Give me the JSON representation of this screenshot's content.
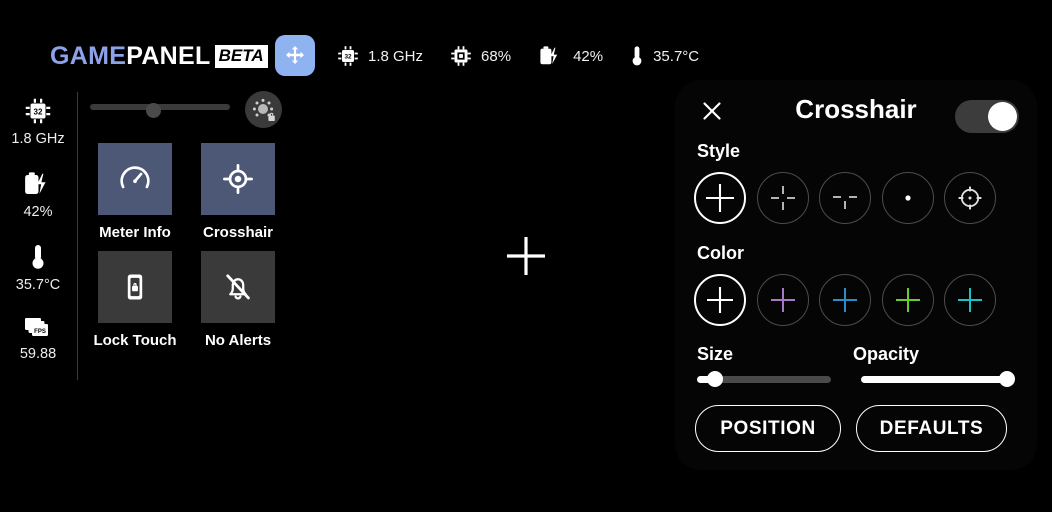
{
  "app": {
    "brand_first": "GAME",
    "brand_second": "PANEL",
    "brand_badge": "BETA",
    "move_icon": "move-arrows-icon",
    "brand_accent": "#8da2e8",
    "move_button_color": "#8fb2f0"
  },
  "statusbar": {
    "items": [
      {
        "icon": "cpu-chip-icon",
        "value": "1.8 GHz"
      },
      {
        "icon": "gpu-chip-icon",
        "value": "68%"
      },
      {
        "icon": "battery-charging-icon",
        "value": "42%"
      },
      {
        "icon": "thermometer-icon",
        "value": "35.7°C"
      }
    ]
  },
  "rail": {
    "items": [
      {
        "icon": "cpu-chip-icon",
        "value": "1.8 GHz"
      },
      {
        "icon": "battery-charging-icon",
        "value": "42%"
      },
      {
        "icon": "thermometer-icon",
        "value": "35.7°C"
      },
      {
        "icon": "fps-frames-icon",
        "value": "59.88"
      }
    ]
  },
  "brightness": {
    "slider_percent": 40,
    "lock_button_icon": "brightness-lock-icon"
  },
  "tiles": [
    {
      "label": "Meter Info",
      "icon": "speedometer-icon",
      "active": true
    },
    {
      "label": "Crosshair",
      "icon": "crosshair-target-icon",
      "active": true
    },
    {
      "label": "Lock Touch",
      "icon": "phone-lock-icon",
      "active": false
    },
    {
      "label": "No Alerts",
      "icon": "bell-off-icon",
      "active": false
    }
  ],
  "overlay_preview": {
    "icon": "crosshair-plus-icon",
    "color": "#ffffff"
  },
  "panel": {
    "title": "Crosshair",
    "close_icon": "close-x-icon",
    "enabled": true,
    "style": {
      "label": "Style",
      "selected_index": 0,
      "options": [
        {
          "name": "plain-cross",
          "selected": true
        },
        {
          "name": "gapped-cross",
          "selected": false
        },
        {
          "name": "t-cross",
          "selected": false
        },
        {
          "name": "dot",
          "selected": false
        },
        {
          "name": "scope-reticle",
          "selected": false
        }
      ]
    },
    "color": {
      "label": "Color",
      "selected_index": 0,
      "options": [
        {
          "name": "white",
          "hex": "#ffffff",
          "selected": true
        },
        {
          "name": "purple",
          "hex": "#a878c8",
          "selected": false
        },
        {
          "name": "blue",
          "hex": "#2b8ccc",
          "selected": false
        },
        {
          "name": "green",
          "hex": "#66cc33",
          "selected": false
        },
        {
          "name": "cyan",
          "hex": "#19c4c4",
          "selected": false
        }
      ]
    },
    "size": {
      "label": "Size",
      "percent": 15
    },
    "opacity": {
      "label": "Opacity",
      "percent": 100
    },
    "buttons": {
      "position": "POSITION",
      "defaults": "DEFAULTS"
    }
  }
}
